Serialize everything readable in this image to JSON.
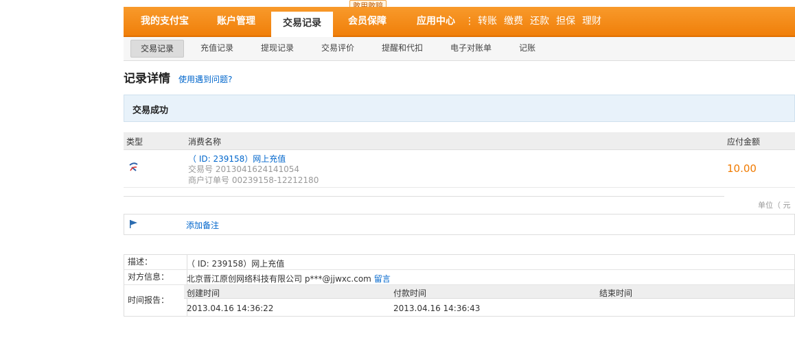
{
  "nav": {
    "items": [
      "我的支付宝",
      "账户管理",
      "交易记录",
      "会员保障",
      "应用中心"
    ],
    "active": "交易记录",
    "separator": "⋮",
    "quick_links": [
      "转账",
      "缴费",
      "还款",
      "担保",
      "理财"
    ],
    "promo_badge": "敢用敢赔"
  },
  "subnav": {
    "items": [
      "交易记录",
      "充值记录",
      "提现记录",
      "交易评价",
      "提醒和代扣",
      "电子对账单",
      "记账"
    ],
    "active": "交易记录"
  },
  "page": {
    "title": "记录详情",
    "help_link": "使用遇到问题?",
    "status": "交易成功"
  },
  "table": {
    "headers": {
      "type": "类型",
      "name": "消费名称",
      "amount": "应付金额"
    },
    "row": {
      "name": "（ ID: 239158）网上充值",
      "trade_no_label": "交易号",
      "trade_no": "2013041624141054",
      "order_no_label": "商户订单号",
      "order_no": "00239158-12212180",
      "amount": "10.00"
    },
    "unit_note": "单位（ 元"
  },
  "remark": {
    "add_label": "添加备注"
  },
  "details": {
    "desc_label": "描述：",
    "desc_value": "（ ID: 239158）网上充值",
    "party_label": "对方信息：",
    "party_value": "北京晋江原创网络科技有限公司 p***@jjwxc.com",
    "party_link": "留言",
    "time_label": "时间报告：",
    "time_headers": [
      "创建时间",
      "付款时间",
      "结束时间"
    ],
    "time_values": [
      "2013.04.16 14:36:22",
      "2013.04.16 14:36:43",
      ""
    ]
  },
  "colors": {
    "nav_orange": "#f07f0a",
    "link_blue": "#0066cc",
    "amount_orange": "#f07a00",
    "status_bg": "#e8f2fa"
  }
}
